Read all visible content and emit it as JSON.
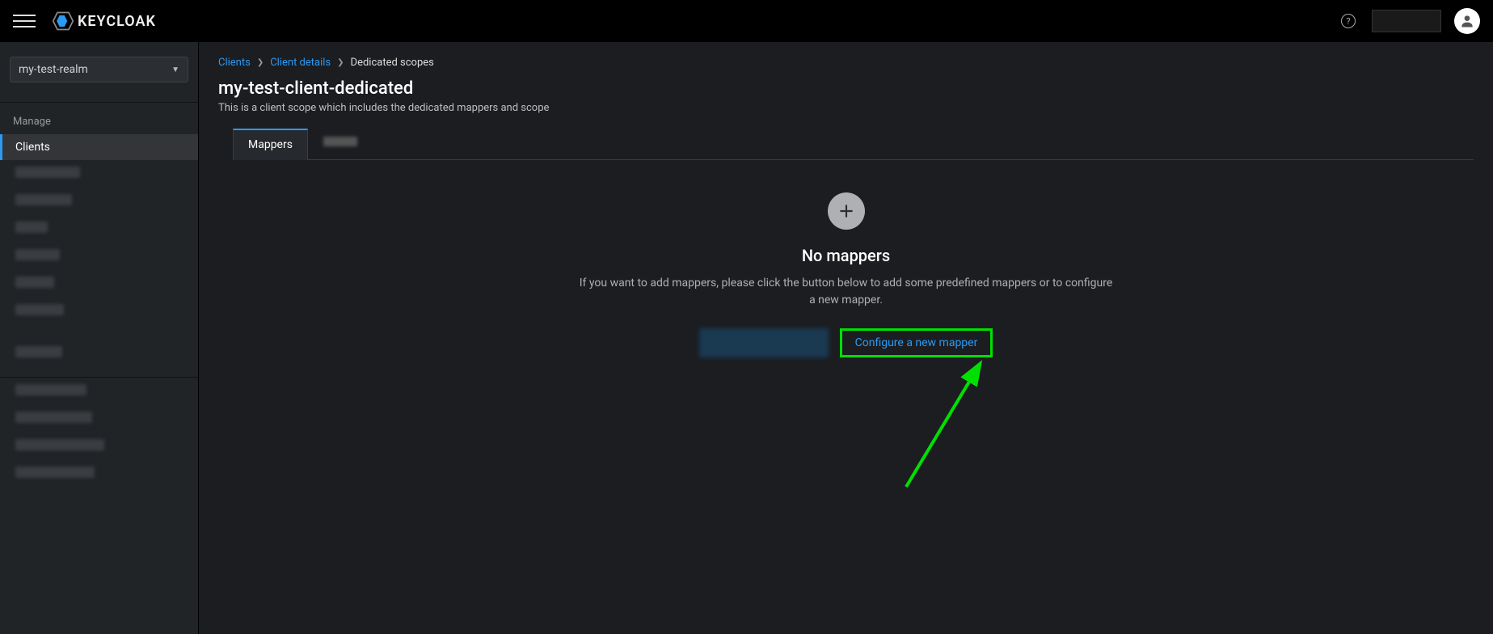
{
  "brand": "KEYCLOAK",
  "realm_selector": {
    "selected": "my-test-realm"
  },
  "sidebar": {
    "sections": {
      "manage_label": "Manage"
    },
    "clients_label": "Clients"
  },
  "breadcrumb": {
    "items": [
      {
        "label": "Clients",
        "link": true
      },
      {
        "label": "Client details",
        "link": true
      },
      {
        "label": "Dedicated scopes",
        "link": false
      }
    ]
  },
  "page": {
    "title": "my-test-client-dedicated",
    "description": "This is a client scope which includes the dedicated mappers and scope"
  },
  "tabs": {
    "mappers": "Mappers"
  },
  "empty": {
    "title": "No mappers",
    "description": "If you want to add mappers, please click the button below to add some predefined mappers or to configure a new mapper.",
    "configure_label": "Configure a new mapper"
  }
}
